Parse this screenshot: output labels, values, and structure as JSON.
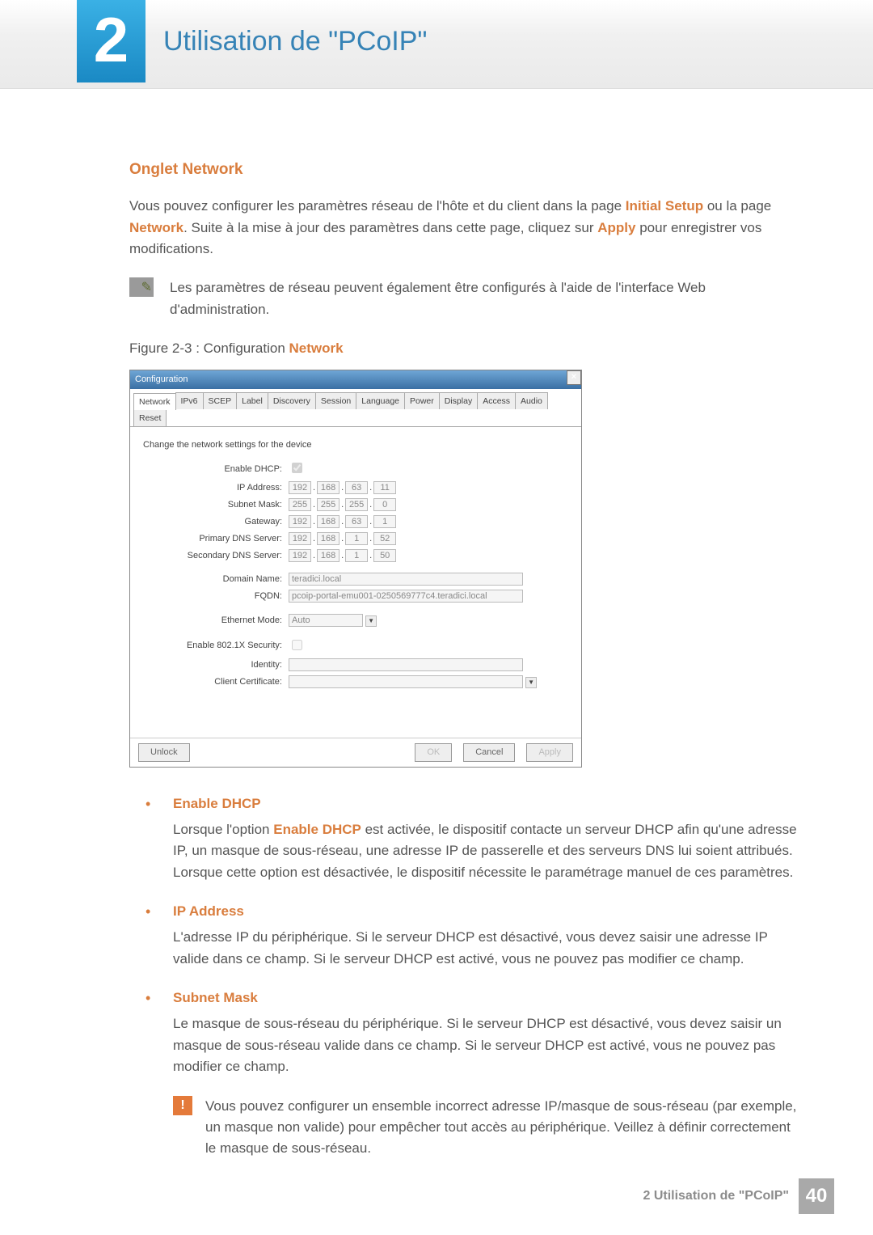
{
  "header": {
    "chapter_number": "2",
    "chapter_title": "Utilisation de \"PCoIP\""
  },
  "section": {
    "heading": "Onglet Network",
    "intro_a": "Vous pouvez configurer les paramètres réseau de l'hôte et du client dans la page ",
    "link_initial_setup": "Initial Setup",
    "intro_b": " ou la page ",
    "link_network": "Network",
    "intro_c": ". Suite à la mise à jour des paramètres dans cette page, cliquez sur ",
    "link_apply": "Apply",
    "intro_d": " pour enregistrer vos modifications.",
    "note": "Les paramètres de réseau peuvent également être configurés à l'aide de l'interface Web d'administration.",
    "figure_caption_a": "Figure 2-3 : Configuration ",
    "figure_caption_b": "Network"
  },
  "config": {
    "title": "Configuration",
    "tabs": [
      "Network",
      "IPv6",
      "SCEP",
      "Label",
      "Discovery",
      "Session",
      "Language",
      "Power",
      "Display",
      "Access",
      "Audio",
      "Reset"
    ],
    "subheading": "Change the network settings for the device",
    "labels": {
      "enable_dhcp": "Enable DHCP:",
      "ip_address": "IP Address:",
      "subnet_mask": "Subnet Mask:",
      "gateway": "Gateway:",
      "primary_dns": "Primary DNS Server:",
      "secondary_dns": "Secondary DNS Server:",
      "domain_name": "Domain Name:",
      "fqdn": "FQDN:",
      "ethernet_mode": "Ethernet Mode:",
      "enable_8021x": "Enable 802.1X Security:",
      "identity": "Identity:",
      "client_cert": "Client Certificate:"
    },
    "values": {
      "ip": [
        "192",
        "168",
        "63",
        "11"
      ],
      "subnet": [
        "255",
        "255",
        "255",
        "0"
      ],
      "gateway": [
        "192",
        "168",
        "63",
        "1"
      ],
      "dns1": [
        "192",
        "168",
        "1",
        "52"
      ],
      "dns2": [
        "192",
        "168",
        "1",
        "50"
      ],
      "domain": "teradici.local",
      "fqdn": "pcoip-portal-emu001-0250569777c4.teradici.local",
      "ethernet": "Auto"
    },
    "buttons": {
      "unlock": "Unlock",
      "ok": "OK",
      "cancel": "Cancel",
      "apply": "Apply"
    }
  },
  "items": {
    "enable_dhcp": {
      "title": "Enable DHCP",
      "body_a": "Lorsque l'option ",
      "body_b": "Enable DHCP",
      "body_c": " est activée, le dispositif contacte un serveur DHCP afin qu'une adresse IP, un masque de sous-réseau, une adresse IP de passerelle et des serveurs DNS lui soient attribués. Lorsque cette option est désactivée, le dispositif nécessite le paramétrage manuel de ces paramètres."
    },
    "ip_address": {
      "title": "IP Address",
      "body": "L'adresse IP du périphérique. Si le serveur DHCP est désactivé, vous devez saisir une adresse IP valide dans ce champ. Si le serveur DHCP est activé, vous ne pouvez pas modifier ce champ."
    },
    "subnet_mask": {
      "title": "Subnet Mask",
      "body": "Le masque de sous-réseau du périphérique. Si le serveur DHCP est désactivé, vous devez saisir un masque de sous-réseau valide dans ce champ. Si le serveur DHCP est activé, vous ne pouvez pas modifier ce champ.",
      "warning": "Vous pouvez configurer un ensemble incorrect adresse IP/masque de sous-réseau (par exemple, un masque non valide) pour empêcher tout accès au périphérique. Veillez à définir correctement le masque de sous-réseau."
    }
  },
  "footer": {
    "text": "2 Utilisation de \"PCoIP\"",
    "page": "40"
  }
}
